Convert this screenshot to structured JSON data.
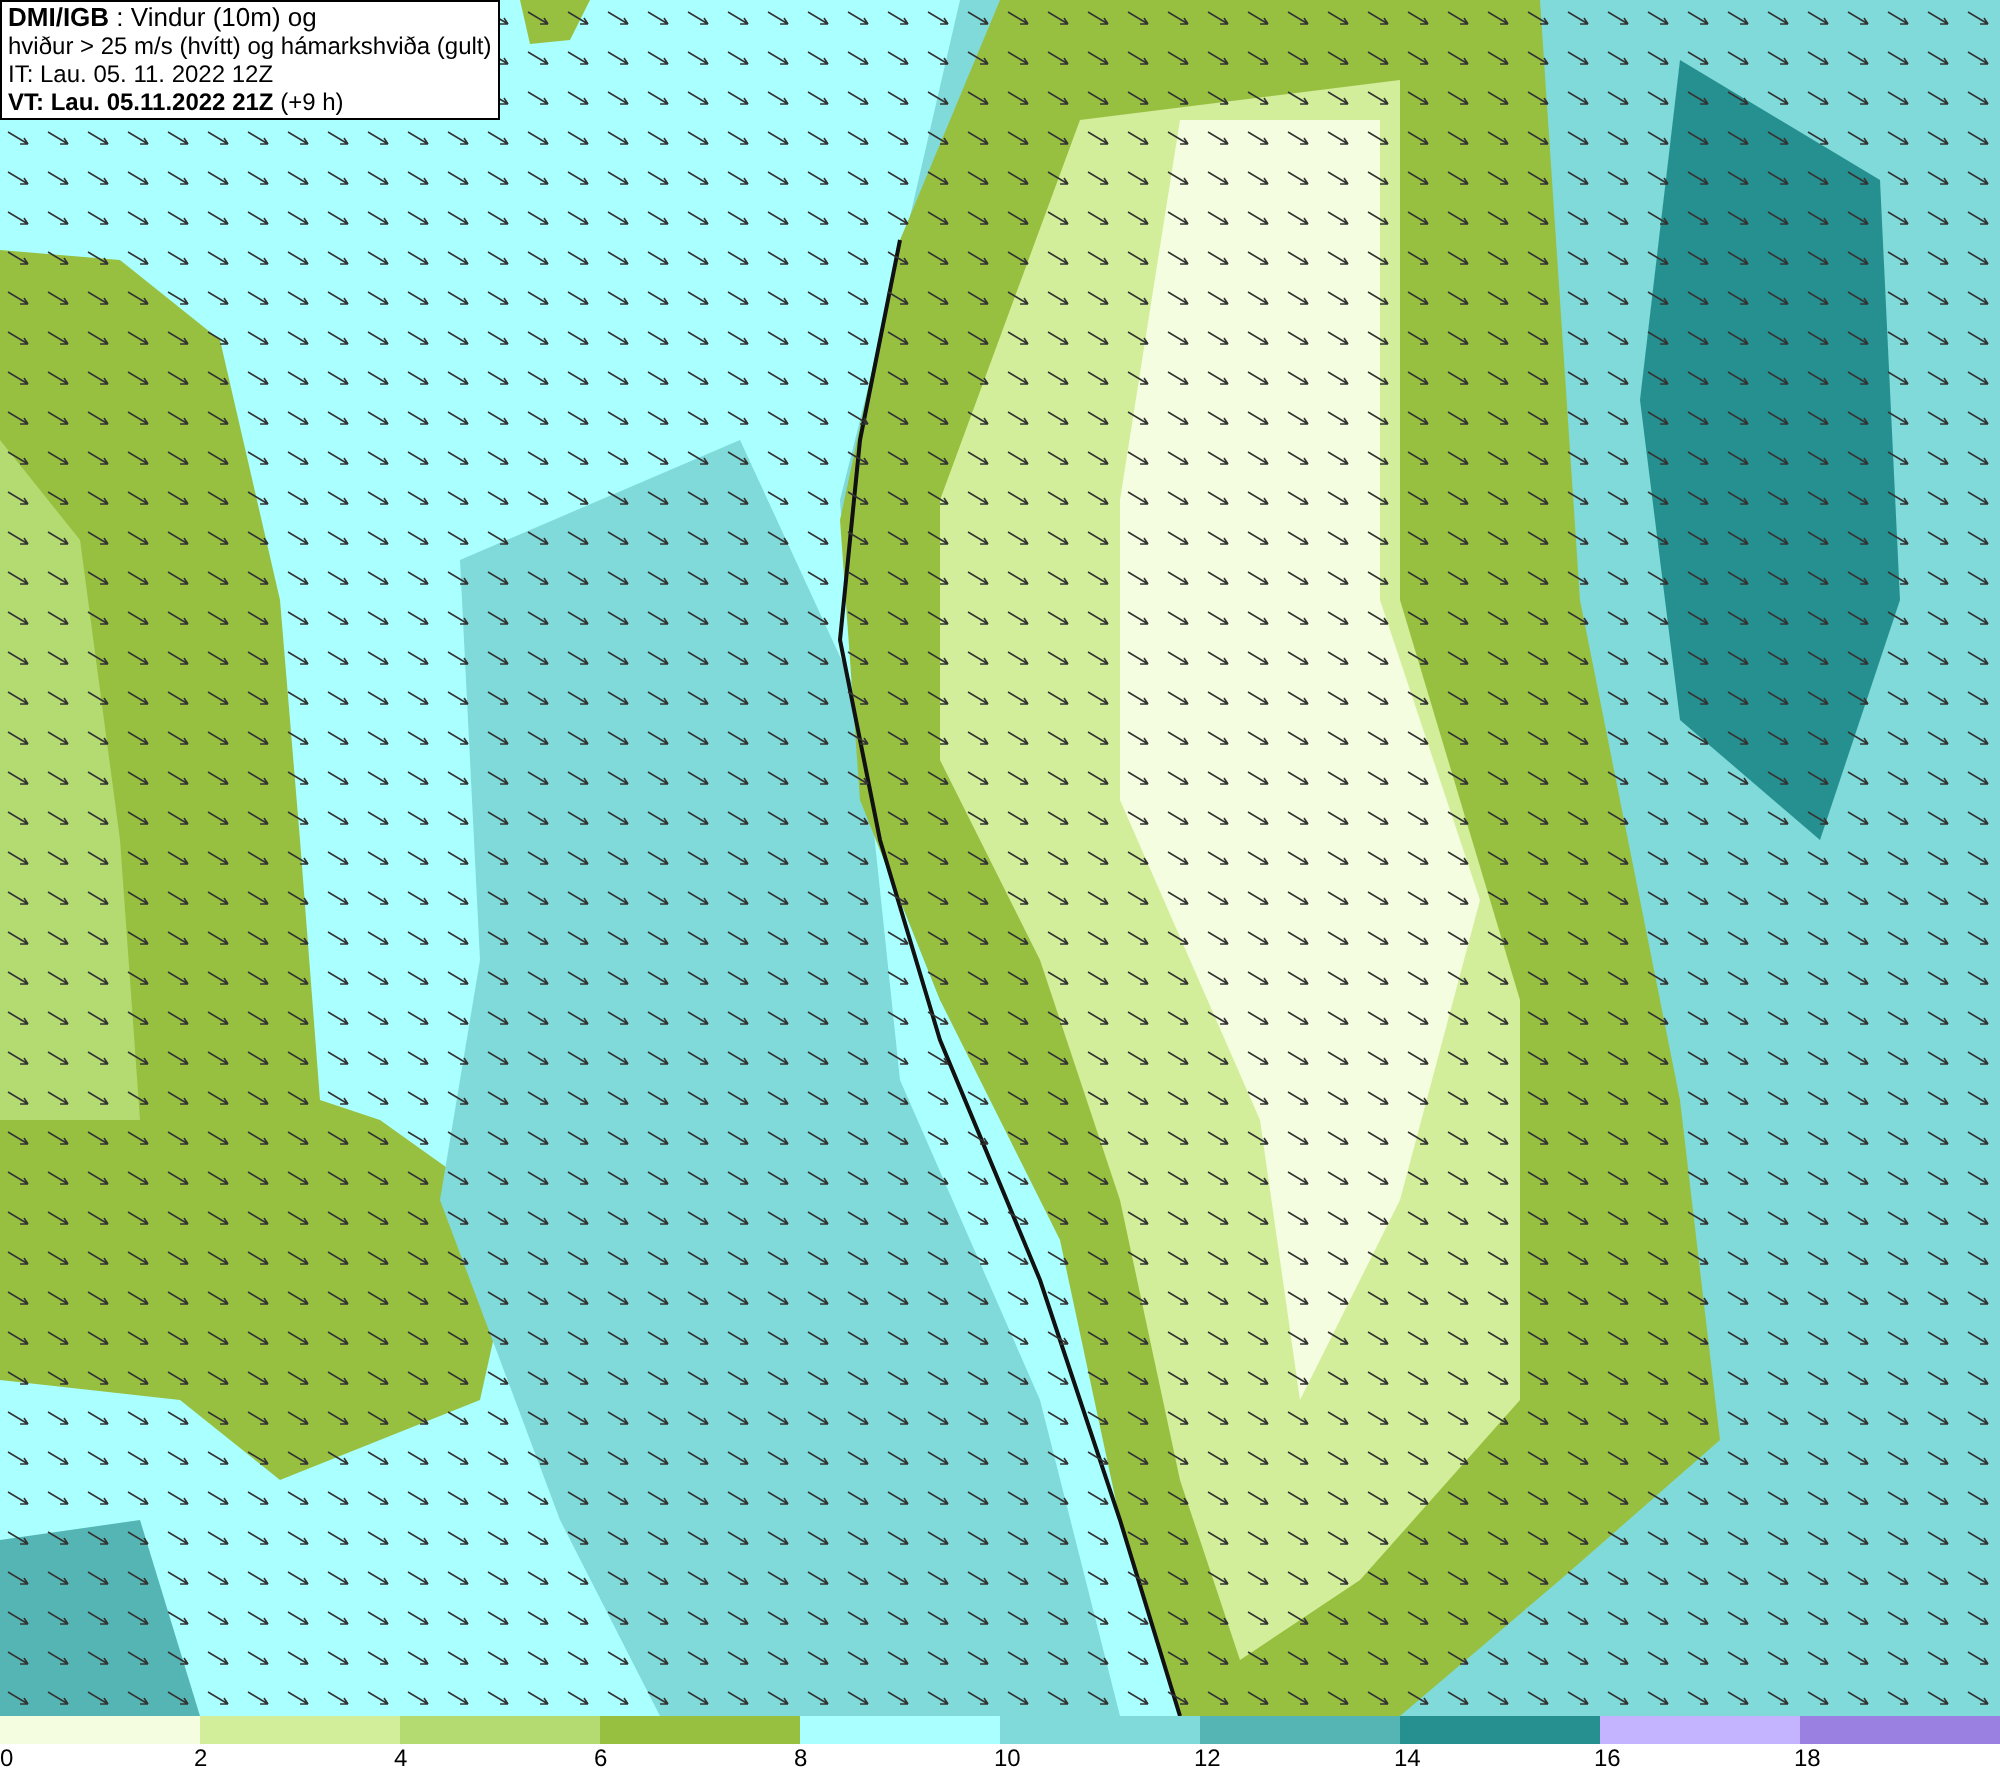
{
  "info_box": {
    "lines": [
      "**DMI/IGB** : Vindur (10m) og",
      "hviður > 25 m/s (hvítt) og hámarkshviða (gult)",
      "IT: Lau. 05. 11. 2022 12Z",
      "**VT: Lau. 05.11.2022 21Z** (+9 h)"
    ]
  },
  "legend": {
    "segments": [
      {
        "color": "#f5fde0"
      },
      {
        "color": "#d3ee9a"
      },
      {
        "color": "#b4da72"
      },
      {
        "color": "#98c040"
      },
      {
        "color": "#aaffff"
      },
      {
        "color": "#80dada"
      },
      {
        "color": "#55b5b5"
      },
      {
        "color": "#269090"
      },
      {
        "color": "#c4b4ff"
      },
      {
        "color": "#9a80e0"
      }
    ],
    "ticks": [
      "0",
      "2",
      "4",
      "6",
      "8",
      "10",
      "12",
      "14",
      "16",
      "18"
    ]
  }
}
